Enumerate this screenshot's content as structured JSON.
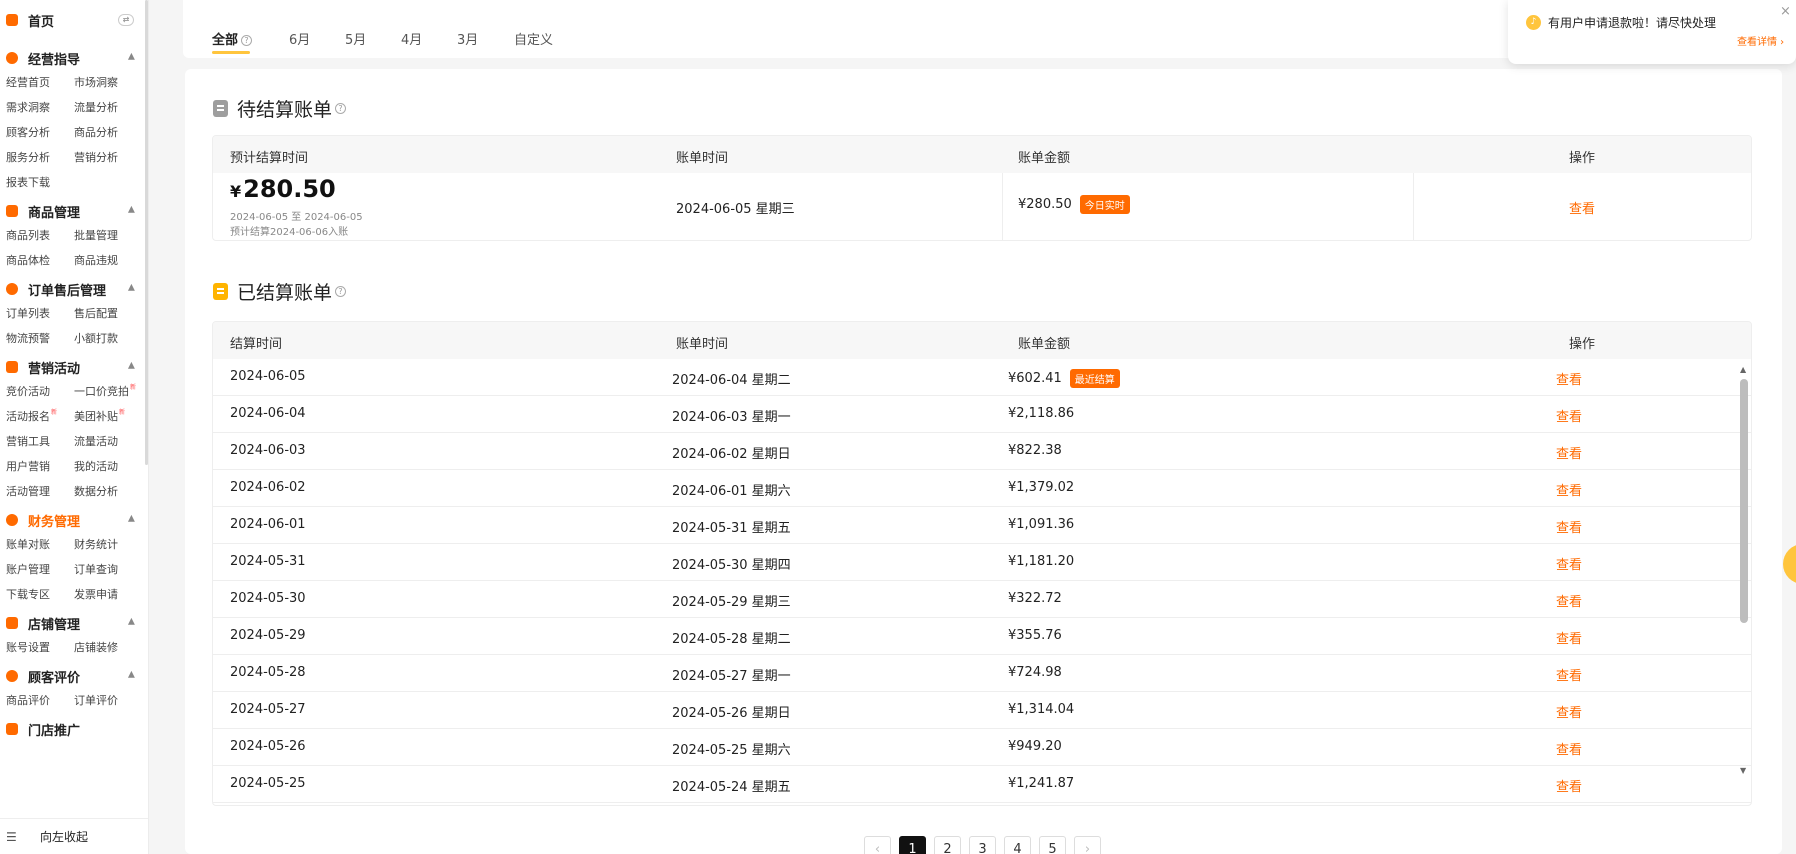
{
  "sidebar": {
    "home_label": "首页",
    "home_switch": "⇄",
    "groups": [
      {
        "title": "经营指导",
        "items": [
          "经营首页",
          "市场洞察",
          "需求洞察",
          "流量分析",
          "顾客分析",
          "商品分析",
          "服务分析",
          "营销分析",
          "报表下载"
        ]
      },
      {
        "title": "商品管理",
        "items": [
          "商品列表",
          "批量管理",
          "商品体检",
          "商品违规"
        ]
      },
      {
        "title": "订单售后管理",
        "items": [
          "订单列表",
          "售后配置",
          "物流预警",
          "小额打款"
        ]
      },
      {
        "title": "营销活动",
        "items": [
          "竞价活动",
          "一口价竞拍",
          "活动报名",
          "美团补贴",
          "营销工具",
          "流量活动",
          "用户营销",
          "我的活动",
          "活动管理",
          "数据分析"
        ]
      },
      {
        "title": "财务管理",
        "items": [
          "账单对账",
          "财务统计",
          "账户管理",
          "订单查询",
          "下载专区",
          "发票申请"
        ]
      },
      {
        "title": "店铺管理",
        "items": [
          "账号设置",
          "店铺装修"
        ]
      },
      {
        "title": "顾客评价",
        "items": [
          "商品评价",
          "订单评价"
        ]
      },
      {
        "title": "门店推广",
        "items": []
      }
    ],
    "new_badge": "新",
    "collapse_label": "向左收起"
  },
  "tabs": [
    "全部",
    "6月",
    "5月",
    "4月",
    "3月",
    "自定义"
  ],
  "tab_help": "?",
  "pending": {
    "title": "待结算账单",
    "help": "?",
    "columns": [
      "预计结算时间",
      "账单时间",
      "账单金额",
      "操作"
    ],
    "currency": "¥",
    "amount": "280.50",
    "range": "2024-06-05 至 2024-06-05",
    "arrival": "预计结算2024-06-06入账",
    "bill_time": "2024-06-05 星期三",
    "bill_amount": "¥280.50",
    "tag": "今日实时",
    "action": "查看"
  },
  "settled": {
    "title": "已结算账单",
    "help": "?",
    "columns": [
      "结算时间",
      "账单时间",
      "账单金额",
      "操作"
    ],
    "latest_tag": "最近结算",
    "rows": [
      {
        "settle": "2024-06-05",
        "bill": "2024-06-04 星期二",
        "amount": "¥602.41",
        "action": "查看"
      },
      {
        "settle": "2024-06-04",
        "bill": "2024-06-03 星期一",
        "amount": "¥2,118.86",
        "action": "查看"
      },
      {
        "settle": "2024-06-03",
        "bill": "2024-06-02 星期日",
        "amount": "¥822.38",
        "action": "查看"
      },
      {
        "settle": "2024-06-02",
        "bill": "2024-06-01 星期六",
        "amount": "¥1,379.02",
        "action": "查看"
      },
      {
        "settle": "2024-06-01",
        "bill": "2024-05-31 星期五",
        "amount": "¥1,091.36",
        "action": "查看"
      },
      {
        "settle": "2024-05-31",
        "bill": "2024-05-30 星期四",
        "amount": "¥1,181.20",
        "action": "查看"
      },
      {
        "settle": "2024-05-30",
        "bill": "2024-05-29 星期三",
        "amount": "¥322.72",
        "action": "查看"
      },
      {
        "settle": "2024-05-29",
        "bill": "2024-05-28 星期二",
        "amount": "¥355.76",
        "action": "查看"
      },
      {
        "settle": "2024-05-28",
        "bill": "2024-05-27 星期一",
        "amount": "¥724.98",
        "action": "查看"
      },
      {
        "settle": "2024-05-27",
        "bill": "2024-05-26 星期日",
        "amount": "¥1,314.04",
        "action": "查看"
      },
      {
        "settle": "2024-05-26",
        "bill": "2024-05-25 星期六",
        "amount": "¥949.20",
        "action": "查看"
      },
      {
        "settle": "2024-05-25",
        "bill": "2024-05-24 星期五",
        "amount": "¥1,241.87",
        "action": "查看"
      }
    ]
  },
  "pagination": {
    "prev": "‹",
    "pages": [
      "1",
      "2",
      "3",
      "4",
      "5"
    ],
    "current": "1",
    "next": "›"
  },
  "notification": {
    "message": "有用户申请退款啦！请尽快处理",
    "link": "查看详情 ›",
    "close": "×"
  },
  "colors": {
    "accent": "#ff6a00",
    "tab_underline": "#ffc53d"
  }
}
